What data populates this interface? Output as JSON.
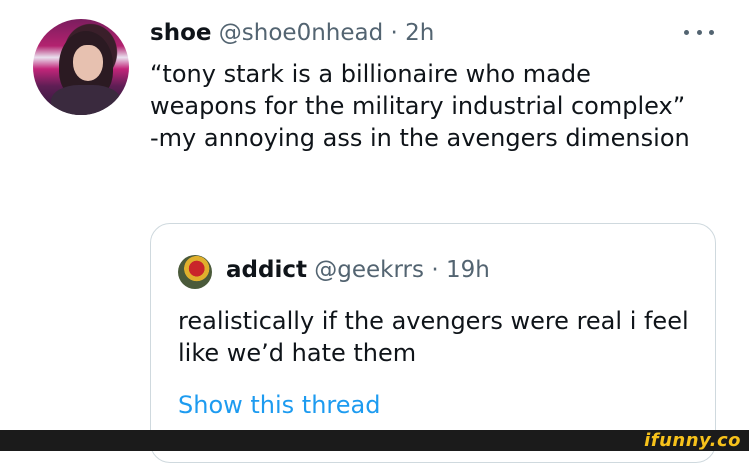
{
  "tweet": {
    "author_name": "shoe",
    "handle": "@shoe0nhead",
    "separator": "·",
    "time": "2h",
    "text": "“tony stark is a billionaire who made weapons for the military industrial complex” -my annoying ass in the avengers dimension"
  },
  "quoted_tweet": {
    "author_name": "addict",
    "handle": "@geekrrs",
    "separator": "·",
    "time": "19h",
    "text": "realistically if the avengers were real i feel like we’d hate them",
    "show_thread_label": "Show this thread"
  },
  "watermark": {
    "text": "ifunny.co",
    "color": "#f7c21b"
  },
  "colors": {
    "text_primary": "#0f1419",
    "text_secondary": "#536471",
    "link": "#1d9bf0",
    "border": "#cfd9de",
    "footer": "#1b1b1b"
  },
  "icons": {
    "more": "more-horizontal-icon"
  }
}
